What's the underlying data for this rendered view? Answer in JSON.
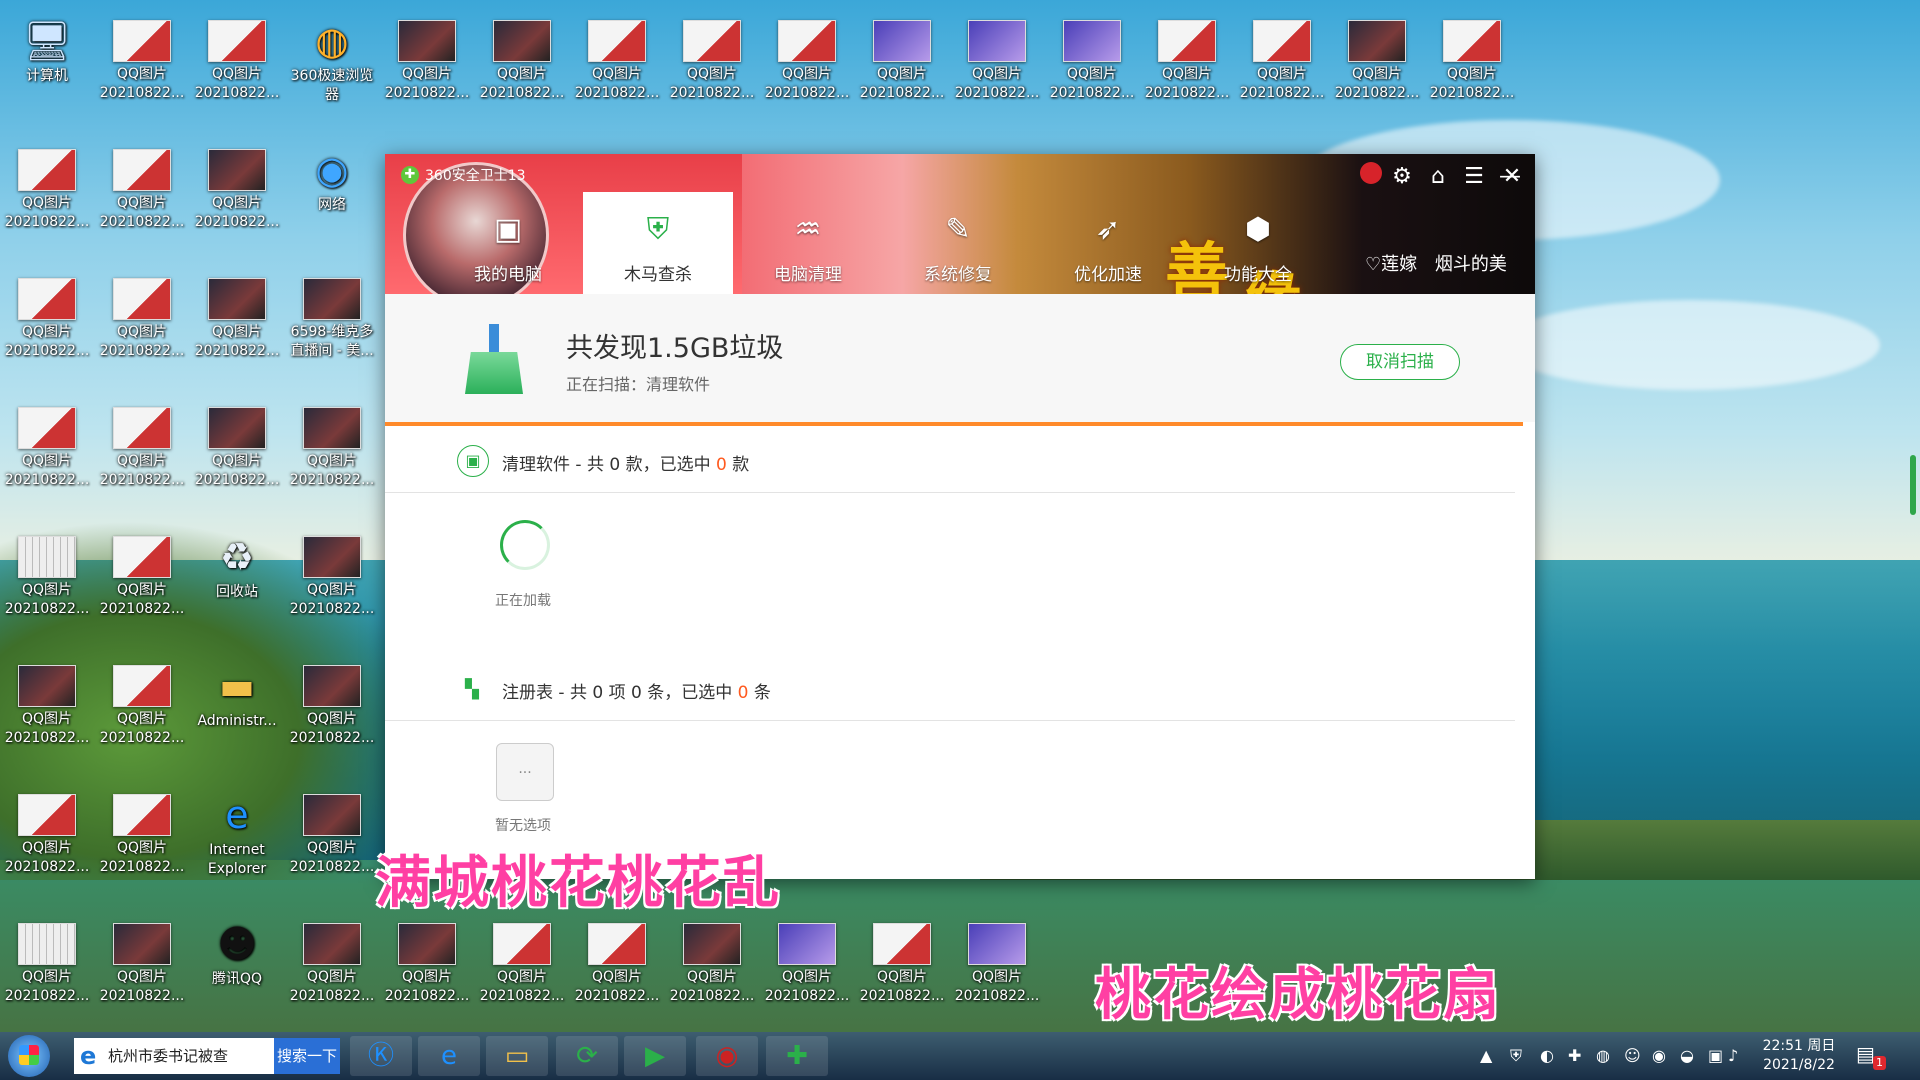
{
  "desktop": {
    "icons": [
      {
        "label": "计算机",
        "kind": "computer"
      },
      {
        "label": "QQ图片\n20210822...",
        "kind": "thumb"
      },
      {
        "label": "QQ图片\n20210822...",
        "kind": "thumb"
      },
      {
        "label": "360极速浏览\n器",
        "kind": "browser360"
      },
      {
        "label": "QQ图片\n20210822...",
        "kind": "dark"
      },
      {
        "label": "QQ图片\n20210822...",
        "kind": "dark"
      },
      {
        "label": "QQ图片\n20210822...",
        "kind": "thumb"
      },
      {
        "label": "QQ图片\n20210822...",
        "kind": "thumb"
      },
      {
        "label": "QQ图片\n20210822...",
        "kind": "thumb"
      },
      {
        "label": "QQ图片\n20210822...",
        "kind": "purple"
      },
      {
        "label": "QQ图片\n20210822...",
        "kind": "purple"
      },
      {
        "label": "QQ图片\n20210822...",
        "kind": "purple"
      },
      {
        "label": "QQ图片\n20210822...",
        "kind": "thumb"
      },
      {
        "label": "QQ图片\n20210822...",
        "kind": "thumb"
      },
      {
        "label": "QQ图片\n20210822...",
        "kind": "dark"
      },
      {
        "label": "QQ图片\n20210822...",
        "kind": "thumb"
      },
      {
        "label": "QQ图片\n20210822...",
        "kind": "thumb"
      },
      {
        "label": "QQ图片\n20210822...",
        "kind": "thumb"
      },
      {
        "label": "QQ图片\n20210822...",
        "kind": "dark"
      },
      {
        "label": "网络",
        "kind": "network"
      },
      {
        "label": "QQ图片\n20210822...",
        "kind": "thumb"
      },
      {
        "label": "QQ图片\n20210822...",
        "kind": "thumb"
      },
      {
        "label": "QQ图片\n20210822...",
        "kind": "dark"
      },
      {
        "label": "6598-维克多\n直播间 - 美...",
        "kind": "dark"
      },
      {
        "label": "QQ图片\n20210822...",
        "kind": "thumb"
      },
      {
        "label": "QQ图片\n20210822...",
        "kind": "thumb"
      },
      {
        "label": "QQ图片\n20210822...",
        "kind": "dark"
      },
      {
        "label": "QQ图片\n20210822...",
        "kind": "dark"
      },
      {
        "label": "QQ图片\n20210822...",
        "kind": "grid"
      },
      {
        "label": "QQ图片\n20210822...",
        "kind": "thumb"
      },
      {
        "label": "回收站",
        "kind": "recycle"
      },
      {
        "label": "QQ图片\n20210822...",
        "kind": "dark"
      },
      {
        "label": "QQ图片\n20210822...",
        "kind": "dark"
      },
      {
        "label": "QQ图片\n20210822...",
        "kind": "thumb"
      },
      {
        "label": "Administr...",
        "kind": "folder"
      },
      {
        "label": "QQ图片\n20210822...",
        "kind": "dark"
      },
      {
        "label": "QQ图片\n20210822...",
        "kind": "thumb"
      },
      {
        "label": "QQ图片\n20210822...",
        "kind": "thumb"
      },
      {
        "label": "Internet\nExplorer",
        "kind": "ie"
      },
      {
        "label": "QQ图片\n20210822...",
        "kind": "dark"
      },
      {
        "label": "QQ图片\n20210822...",
        "kind": "grid"
      },
      {
        "label": "QQ图片\n20210822...",
        "kind": "dark"
      },
      {
        "label": "腾讯QQ",
        "kind": "qq"
      },
      {
        "label": "QQ图片\n20210822...",
        "kind": "dark"
      },
      {
        "label": "QQ图片\n20210822...",
        "kind": "dark"
      },
      {
        "label": "QQ图片\n20210822...",
        "kind": "thumb"
      },
      {
        "label": "QQ图片\n20210822...",
        "kind": "thumb"
      },
      {
        "label": "QQ图片\n20210822...",
        "kind": "dark"
      },
      {
        "label": "QQ图片\n20210822...",
        "kind": "purple"
      },
      {
        "label": "QQ图片\n20210822...",
        "kind": "thumb"
      },
      {
        "label": "QQ图片\n20210822...",
        "kind": "purple"
      }
    ]
  },
  "app360": {
    "title": "360安全卫士13",
    "nav": [
      {
        "label": "我的电脑",
        "icon": "monitor-icon",
        "glyph": "▣"
      },
      {
        "label": "木马查杀",
        "icon": "shield-bolt-icon",
        "glyph": "⛨"
      },
      {
        "label": "电脑清理",
        "icon": "broom-icon",
        "glyph": "♒"
      },
      {
        "label": "系统修复",
        "icon": "wrench-icon",
        "glyph": "✎"
      },
      {
        "label": "优化加速",
        "icon": "rocket-icon",
        "glyph": "➶"
      },
      {
        "label": "功能大全",
        "icon": "cube-icon",
        "glyph": "⬢"
      }
    ],
    "user_badges": [
      "♡莲嫁",
      "烟斗的美"
    ],
    "summary": {
      "title": "共发现1.5GB垃圾",
      "status": "正在扫描：清理软件",
      "cancel_label": "取消扫描"
    },
    "sections": [
      {
        "prefix": "清理软件 - 共 0 款，已选中 ",
        "count": "0",
        "suffix": " 款"
      },
      {
        "prefix": "注册表 - 共 0 项 0 条，已选中 ",
        "count": "0",
        "suffix": " 条"
      }
    ],
    "loading_label": "正在加载",
    "empty_button": "...",
    "empty_label": "暂无选项"
  },
  "lyrics": {
    "line1": "满城桃花桃花乱",
    "line2": "桃花绘成桃花扇"
  },
  "taskbar": {
    "search_value": "杭州市委书记被查",
    "search_button": "搜索一下",
    "apps": [
      {
        "name": "kugou-icon",
        "glyph": "Ⓚ"
      },
      {
        "name": "ie-icon",
        "glyph": "e"
      },
      {
        "name": "folder-icon",
        "glyph": "▭"
      },
      {
        "name": "browser-icon",
        "glyph": "⟳"
      },
      {
        "name": "video-player-icon",
        "glyph": "▶"
      },
      {
        "name": "live-stream-icon",
        "glyph": "◉"
      },
      {
        "name": "360-guard-icon",
        "glyph": "✚"
      }
    ],
    "clock_time": "22:51 周日",
    "clock_date": "2021/8/22",
    "notification_count": "1"
  },
  "colors": {
    "accent_green": "#2bb04a",
    "progress_orange": "#ff8a2a",
    "header_red": "#e83f48",
    "lyric_pink": "#ff3fa3"
  }
}
